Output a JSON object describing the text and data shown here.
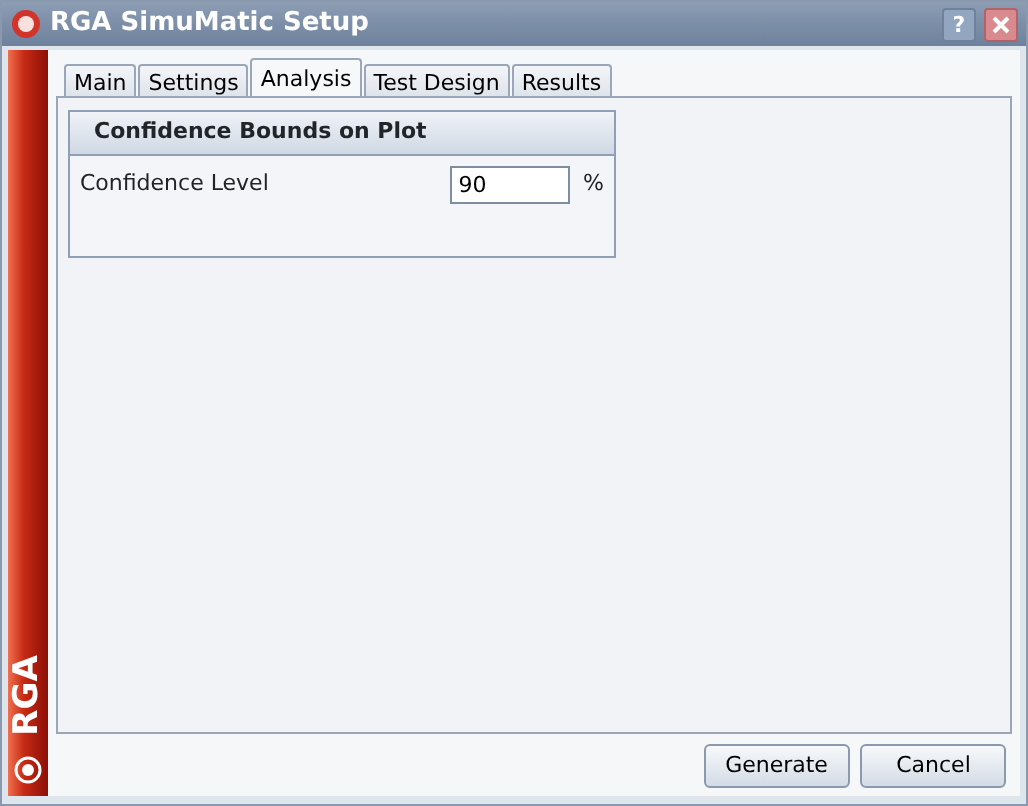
{
  "window": {
    "title": "RGA SimuMatic Setup",
    "help_button": "?"
  },
  "sidebar": {
    "label": "RGA"
  },
  "tabs": [
    {
      "label": "Main",
      "selected": false
    },
    {
      "label": "Settings",
      "selected": false
    },
    {
      "label": "Analysis",
      "selected": true
    },
    {
      "label": "Test Design",
      "selected": false
    },
    {
      "label": "Results",
      "selected": false
    }
  ],
  "group": {
    "title": "Confidence Bounds on Plot",
    "field": {
      "label": "Confidence Level",
      "value": "90",
      "unit": "%"
    }
  },
  "buttons": [
    "Generate",
    "Cancel"
  ]
}
